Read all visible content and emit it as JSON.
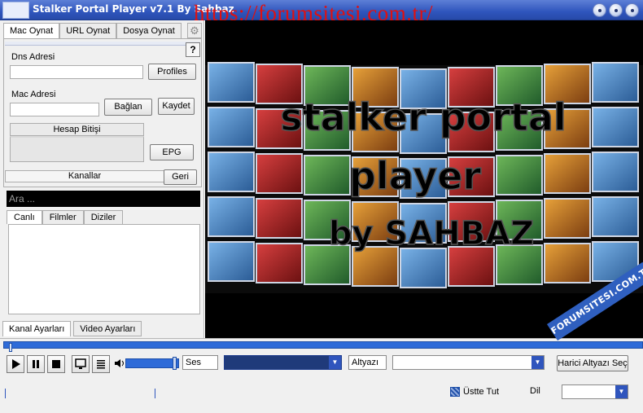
{
  "window": {
    "title": "Stalker Portal Player v7.1 By Sahbaz",
    "watermark_url": "https://forumsitesi.com.tr/"
  },
  "left_panel": {
    "tabs": [
      "Mac Oynat",
      "URL Oynat",
      "Dosya Oynat"
    ],
    "active_tab": "Mac Oynat",
    "help_label": "?",
    "dns_label": "Dns Adresi",
    "dns_value": "",
    "profiles_label": "Profiles",
    "mac_label": "Mac Adresi",
    "mac_value": "",
    "connect_label": "Bağlan",
    "save_label": "Kaydet",
    "account_expiry_label": "Hesap Bitişi",
    "epg_label": "EPG",
    "channels_label": "Kanallar",
    "back_label": "Geri",
    "search_placeholder": "Ara ...",
    "sub_tabs": [
      "Canlı",
      "Filmler",
      "Diziler"
    ],
    "active_sub_tab": "Canlı",
    "bottom_tabs": [
      "Kanal Ayarları",
      "Video Ayarları"
    ]
  },
  "video": {
    "overlay_lines": [
      "stalker portal",
      "player",
      "by SAHBAZ"
    ]
  },
  "controls": {
    "sound_label": "Ses",
    "audio_track_value": "",
    "subtitle_label": "Altyazı",
    "subtitle_value": "",
    "external_player_label": "Harici Altyazı Seç",
    "always_on_top_label": "Üstte Tut",
    "language_label": "Dil",
    "accent_color": "#2f55bd"
  },
  "watermark_stamp": "FORUMSITESI.COM.TR"
}
